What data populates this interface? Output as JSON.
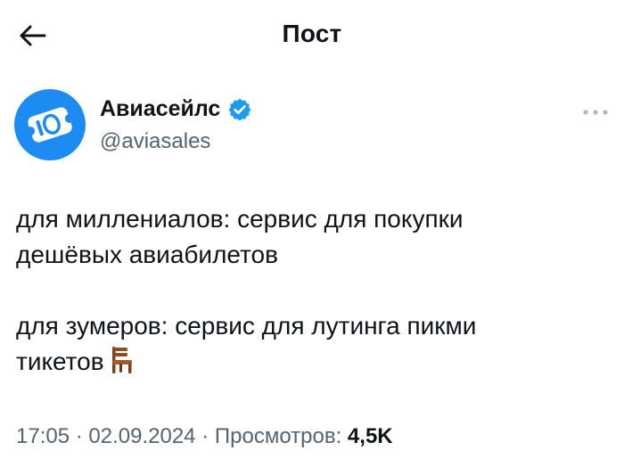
{
  "header": {
    "back_icon": "arrow-left-icon",
    "title": "Пост"
  },
  "author": {
    "avatar_icon": "aviasales-logo-icon",
    "name": "Авиасейлс",
    "verified_icon": "verified-badge-icon",
    "handle": "@aviasales",
    "more_icon": "more-horizontal-icon"
  },
  "post": {
    "line1": "для миллениалов: сервис для покупки",
    "line2": "дешёвых авиабилетов",
    "line3": "для зумеров: сервис для лутинга пикми",
    "line4": "тикетов",
    "emoji_icon": "chair-icon"
  },
  "meta": {
    "time": "17:05",
    "separator": "·",
    "date": "02.09.2024",
    "views_label": "Просмотров:",
    "views_count": "4,5K"
  },
  "colors": {
    "brand": "#1c8cf2",
    "verified": "#1d9bf0",
    "text": "#0f1419",
    "secondary": "#536471"
  }
}
